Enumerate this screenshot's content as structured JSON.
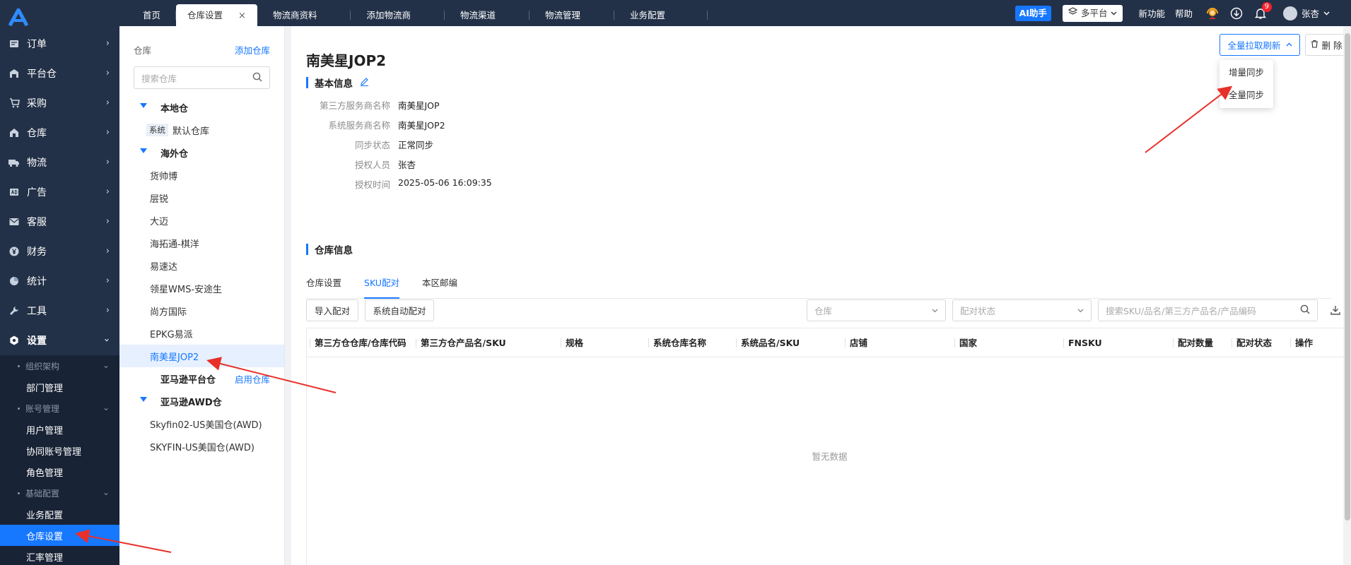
{
  "header": {
    "tabs": [
      {
        "label": "首页"
      },
      {
        "label": "仓库设置",
        "close": "×"
      },
      {
        "label": "物流商资料"
      },
      {
        "label": "添加物流商"
      },
      {
        "label": "物流渠道"
      },
      {
        "label": "物流管理"
      },
      {
        "label": "业务配置"
      }
    ],
    "ai_label": "AI助手",
    "platform_label": "多平台",
    "new_feature": "新功能",
    "help": "帮助",
    "notif_count": "9",
    "user_name": "张杏"
  },
  "sidebar": {
    "items": [
      {
        "label": "订单",
        "icon": "order-icon"
      },
      {
        "label": "平台仓",
        "icon": "warehouse-icon"
      },
      {
        "label": "采购",
        "icon": "cart-icon"
      },
      {
        "label": "仓库",
        "icon": "house-icon"
      },
      {
        "label": "物流",
        "icon": "truck-icon"
      },
      {
        "label": "广告",
        "icon": "ad-icon"
      },
      {
        "label": "客服",
        "icon": "mail-icon"
      },
      {
        "label": "财务",
        "icon": "yen-icon"
      },
      {
        "label": "统计",
        "icon": "pie-chart-icon"
      },
      {
        "label": "工具",
        "icon": "wrench-icon"
      },
      {
        "label": "设置",
        "icon": "gear-icon"
      }
    ],
    "groups": [
      {
        "label": "组织架构",
        "leaves": [
          "部门管理"
        ]
      },
      {
        "label": "账号管理",
        "leaves": [
          "用户管理",
          "协同账号管理",
          "角色管理"
        ]
      },
      {
        "label": "基础配置",
        "leaves": [
          "业务配置",
          "仓库设置",
          "汇率管理"
        ]
      }
    ]
  },
  "warehouse_panel": {
    "title": "仓库",
    "add_link": "添加仓库",
    "search_placeholder": "搜索仓库",
    "local_group": "本地仓",
    "system_tag": "系统",
    "default_wh": "默认仓库",
    "overseas_group": "海外仓",
    "overseas_items": [
      "货帅博",
      "层锐",
      "大迈",
      "海拓通-棋洋",
      "易速达",
      "领星WMS-安途生",
      "尚方国际",
      "EPKG易派",
      "南美星JOP2"
    ],
    "amazon_group": "亚马逊平台仓",
    "enable_link": "启用仓库",
    "awd_group": "亚马逊AWD仓",
    "awd_items": [
      "Skyfin02-US美国仓(AWD)",
      "SKYFIN-US美国仓(AWD)"
    ]
  },
  "detail": {
    "title": "南美星JOP2",
    "basic_section": "基本信息",
    "fields": [
      {
        "label": "第三方服务商名称",
        "value": "南美星JOP"
      },
      {
        "label": "系统服务商名称",
        "value": "南美星JOP2"
      },
      {
        "label": "同步状态",
        "value": "正常同步"
      },
      {
        "label": "授权人员",
        "value": "张杏"
      },
      {
        "label": "授权时间",
        "value": "2025-05-06 16:09:35"
      }
    ],
    "full_pull_label": "全量拉取刷新",
    "delete_label": "删 除",
    "dropdown": [
      "增量同步",
      "全量同步"
    ],
    "warehouse_section": "仓库信息",
    "subtabs": [
      "仓库设置",
      "SKU配对",
      "本区邮编"
    ],
    "import_btn": "导入配对",
    "auto_btn": "系统自动配对",
    "warehouse_select": "仓库",
    "status_select": "配对状态",
    "search_placeholder": "搜索SKU/品名/第三方产品名/产品编码",
    "columns": [
      "第三方仓仓库/仓库代码",
      "第三方仓产品名/SKU",
      "规格",
      "系统仓库名称",
      "系统品名/SKU",
      "店铺",
      "国家",
      "FNSKU",
      "配对数量",
      "配对状态",
      "操作"
    ],
    "empty_text": "暂无数据"
  },
  "colors": {
    "accent": "#1677ff",
    "sidebar": "#233148",
    "annotation": "#e8302a"
  }
}
